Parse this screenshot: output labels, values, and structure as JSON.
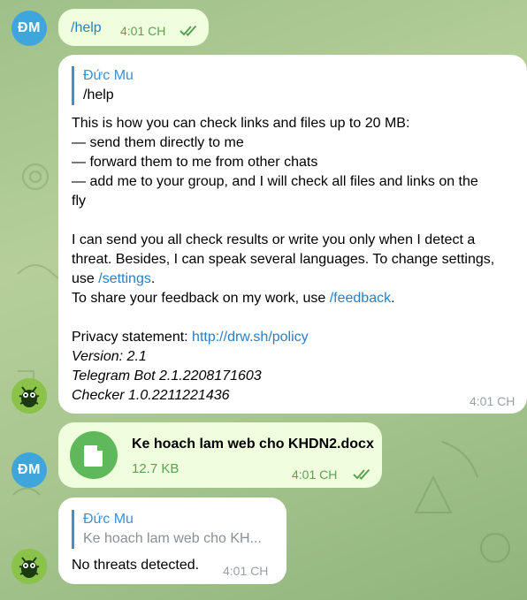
{
  "messages": {
    "help_cmd": {
      "avatar": "ĐM",
      "text": "/help",
      "time": "4:01 CH"
    },
    "help_reply": {
      "quote_author": "Đức Mu",
      "quote_text": "/help",
      "line1": "This is how you can check links and files up to 20 MB:",
      "line2": "— send them directly to me",
      "line3": "— forward them to me from other chats",
      "line4a": "— add me to your group, and I will check all files and links on the",
      "line4b": "fly",
      "para2a": "I can send you all check results or write you only when I detect a",
      "para2b": "threat. Besides, I can speak several languages. To change settings,",
      "para2c_pre": "use ",
      "settings_link": "/settings",
      "para2c_post": ".",
      "para3_pre": "To share your feedback on my work, use ",
      "feedback_link": "/feedback",
      "para3_post": ".",
      "privacy_pre": "Privacy statement: ",
      "privacy_link": "http://drw.sh/policy",
      "version": "Version: 2.1",
      "bot_version": "Telegram Bot 2.1.2208171603",
      "checker_version": "Checker 1.0.2211221436",
      "time": "4:01 CH"
    },
    "file_msg": {
      "avatar": "ĐM",
      "file_name": "Ke hoach lam web cho KHDN2.docx",
      "file_size": "12.7 KB",
      "time": "4:01 CH"
    },
    "scan_reply": {
      "quote_author": "Đức Mu",
      "quote_text": "Ke hoach lam web cho KH...",
      "text": "No threats detected.",
      "time": "4:01 CH"
    }
  },
  "colors": {
    "outgoing_bubble": "#effedd",
    "incoming_bubble": "#ffffff",
    "link": "#2b7fc4",
    "avatar_user": "#3fa6dc",
    "avatar_bot": "#7cb342",
    "file_icon": "#5fb85a"
  },
  "icons": {
    "read_status": "double-check-icon",
    "file": "document-icon",
    "bot_avatar": "bug-logo-icon"
  }
}
